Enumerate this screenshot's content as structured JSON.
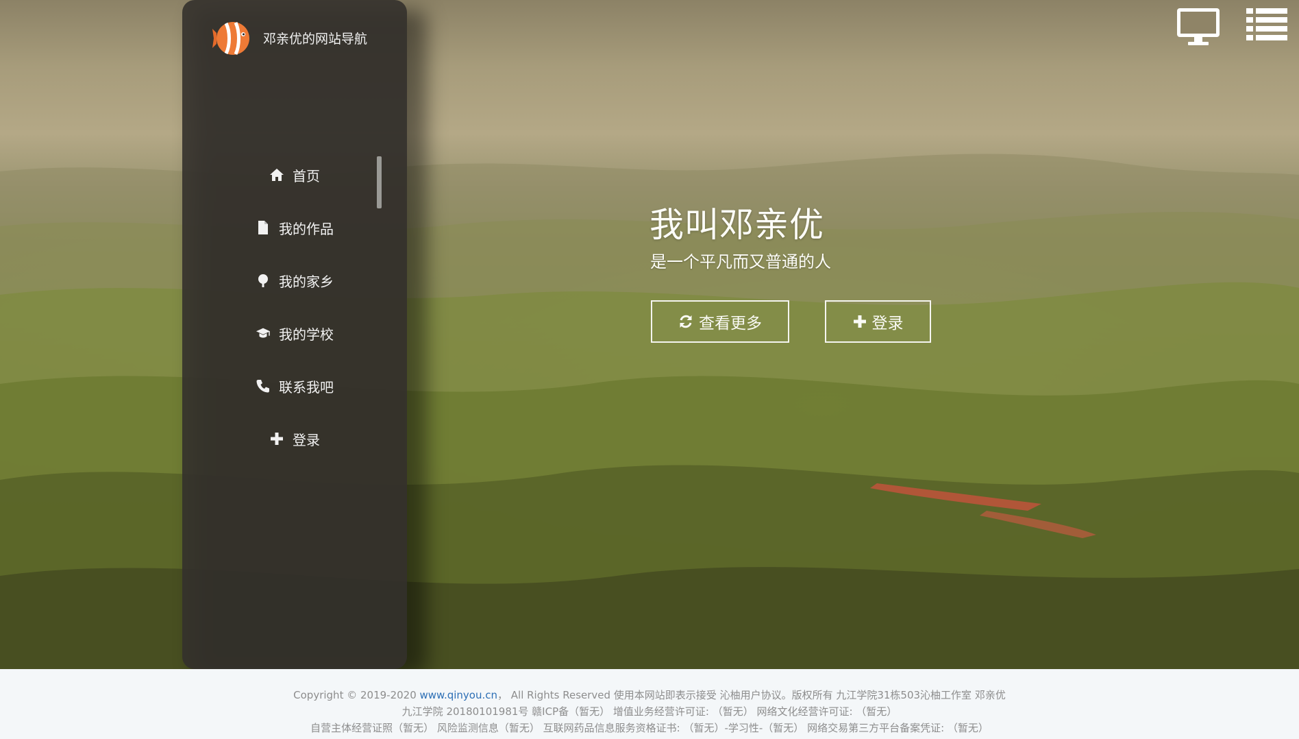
{
  "brand": {
    "name": "邓亲优的网站导航",
    "logo_icon": "clownfish-logo"
  },
  "nav": {
    "items": [
      {
        "label": "首页",
        "icon": "home-icon"
      },
      {
        "label": "我的作品",
        "icon": "file-icon"
      },
      {
        "label": "我的家乡",
        "icon": "tree-icon"
      },
      {
        "label": "我的学校",
        "icon": "graduation-cap-icon"
      },
      {
        "label": "联系我吧",
        "icon": "phone-icon"
      },
      {
        "label": "登录",
        "icon": "plus-icon"
      }
    ]
  },
  "hero": {
    "title": "我叫邓亲优",
    "subtitle": "是一个平凡而又普通的人",
    "more_button": "查看更多",
    "login_button": "登录"
  },
  "top_icons": [
    "monitor-icon",
    "list-icon"
  ],
  "footer": {
    "line1_prefix": "Copyright  ©   2019-2020  ",
    "line1_link": "www.qinyou.cn",
    "line1_suffix": "，   All  Rights   Reserved    使用本网站即表示接受   沁柚用户协议。版权所有   九江学院31栋503沁柚工作室 邓亲优",
    "line2": "九江学院 20180101981号    赣ICP备（暂无）    增值业务经营许可证:     （暂无）   网络文化经营许可证:   （暂无）",
    "line3": "自营主体经营证照（暂无）     风险监测信息（暂无）     互联网药品信息服务资格证书:    （暂无）-学习性-（暂无）     网络交易第三方平台备案凭证:    （暂无）"
  },
  "colors": {
    "sidebar_bg": "#34312c",
    "footer_link": "#2d6fb5",
    "footer_text": "#8d8d8d",
    "logo_orange": "#ee7a36"
  }
}
